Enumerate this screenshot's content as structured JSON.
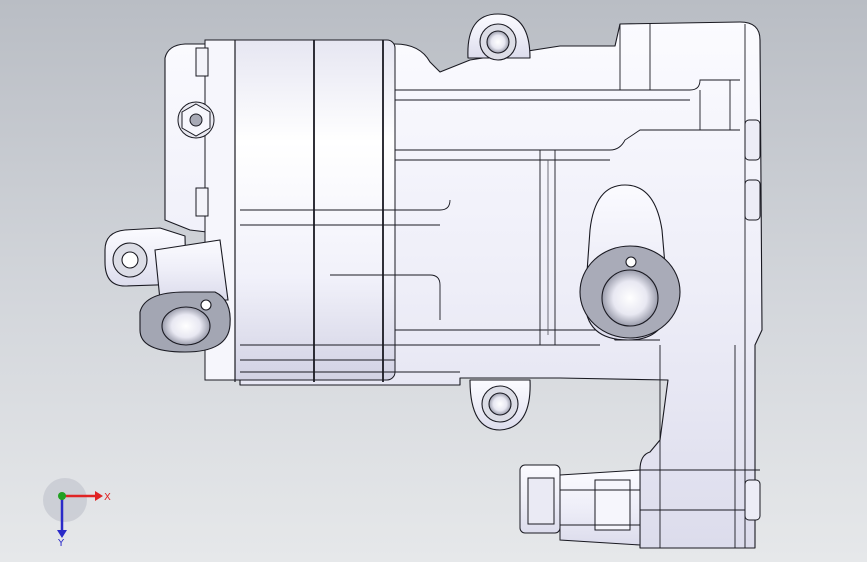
{
  "viewport": {
    "background_top": "#b9bdc4",
    "background_bottom": "#e6e8ea"
  },
  "model": {
    "body_color": "#f4f4fb",
    "shade_color": "#d9d9ea",
    "edge_color": "#1a1a22",
    "flange_color": "#9ea1ae"
  },
  "triad": {
    "x_label": "X",
    "y_label": "Y",
    "x_color": "#e02424",
    "y_color": "#2a2ac8",
    "z_color": "#22a022"
  }
}
